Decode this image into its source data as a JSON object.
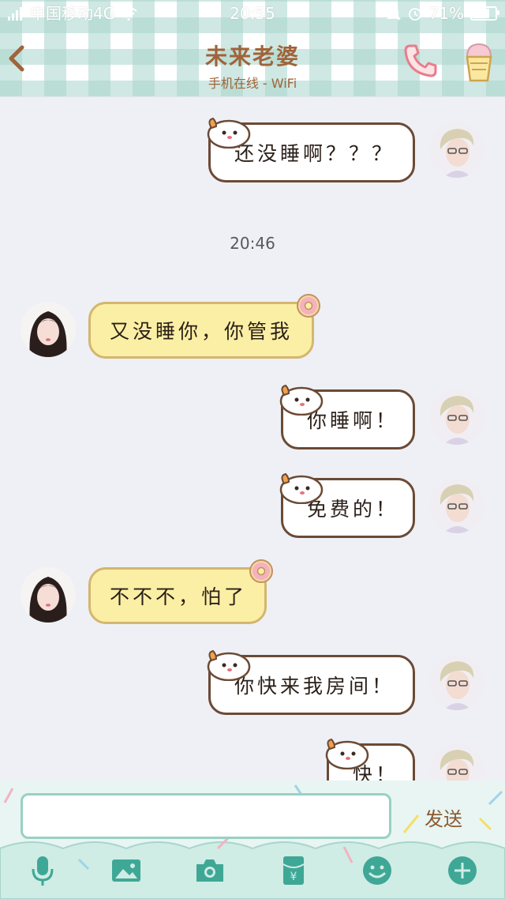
{
  "status_bar": {
    "carrier": "中国移动4G",
    "time": "20:55",
    "battery": "71%",
    "battery_level": 0.71
  },
  "header": {
    "contact_name": "未来老婆",
    "contact_status": "手机在线 - WiFi"
  },
  "chat": {
    "timestamp": "20:46",
    "messages": [
      {
        "direction": "outgoing",
        "text": "还没睡啊？？？"
      },
      {
        "direction": "incoming",
        "text": "又没睡你，你管我"
      },
      {
        "direction": "outgoing",
        "text": "你睡啊！"
      },
      {
        "direction": "outgoing",
        "text": "免费的！"
      },
      {
        "direction": "incoming",
        "text": "不不不，怕了"
      },
      {
        "direction": "outgoing",
        "text": "你快来我房间！"
      },
      {
        "direction": "outgoing",
        "text": "快！"
      }
    ]
  },
  "input": {
    "value": "",
    "send_label": "发送"
  },
  "toolbar": {
    "icons": [
      "microphone-icon",
      "image-icon",
      "camera-icon",
      "red-packet-icon",
      "emoji-icon",
      "plus-icon"
    ]
  },
  "colors": {
    "header_check": "#a8d6cc",
    "title": "#a0633a",
    "outgoing_border": "#6b4a35",
    "incoming_bubble": "#fbefa5",
    "toolbar_icon": "#3fa796",
    "chat_background": "#eef0f5"
  }
}
